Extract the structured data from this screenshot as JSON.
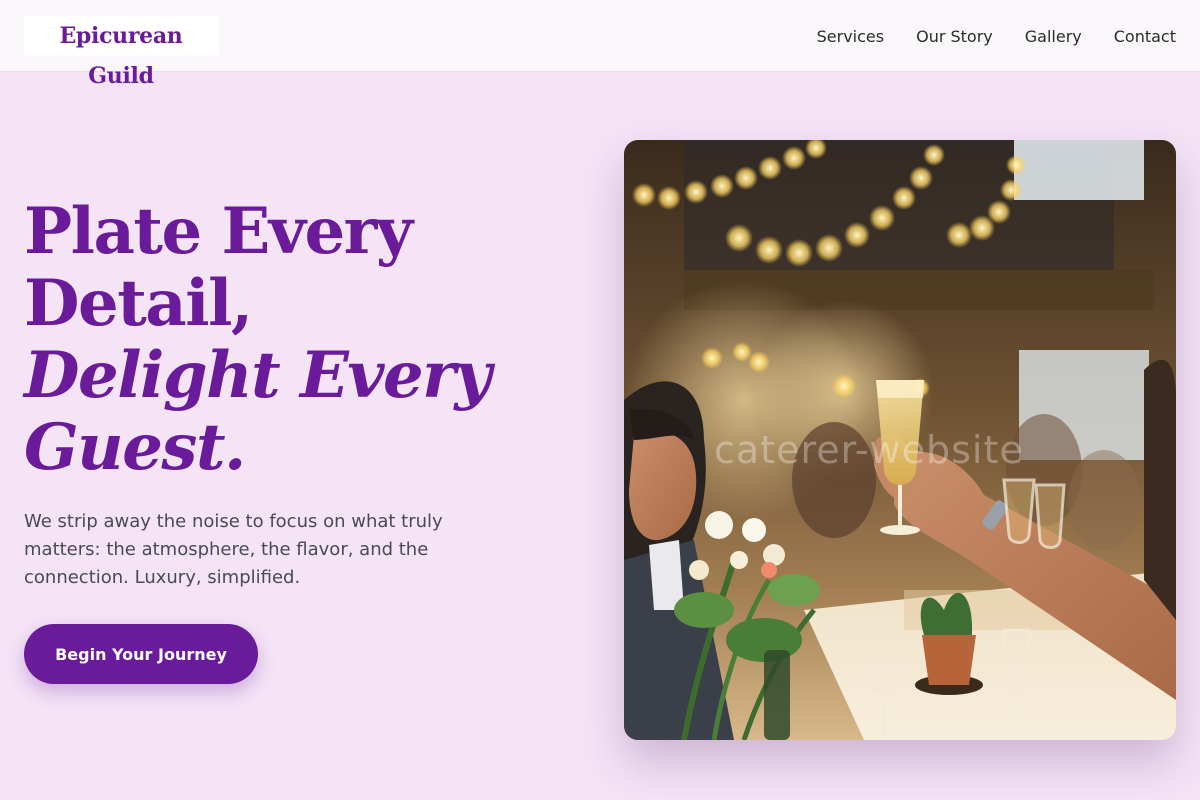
{
  "header": {
    "brand": "Epicurean Guild",
    "nav": [
      "Services",
      "Our Story",
      "Gallery",
      "Contact"
    ]
  },
  "hero": {
    "title_line1": "Plate Every",
    "title_line2": "Detail,",
    "title_line3": "Delight Every",
    "title_line4": "Guest.",
    "description": "We strip away the noise to focus on what truly matters: the atmosphere, the flavor, and the connection. Luxury, simplified.",
    "cta_label": "Begin Your Journey"
  },
  "image": {
    "watermark": "caterer-website",
    "icon": "celebration-photo-icon"
  },
  "colors": {
    "accent": "#6a1b9a",
    "background": "#f4e4f6",
    "header_bg": "#faf7fb",
    "body_text": "#4a4a55"
  }
}
